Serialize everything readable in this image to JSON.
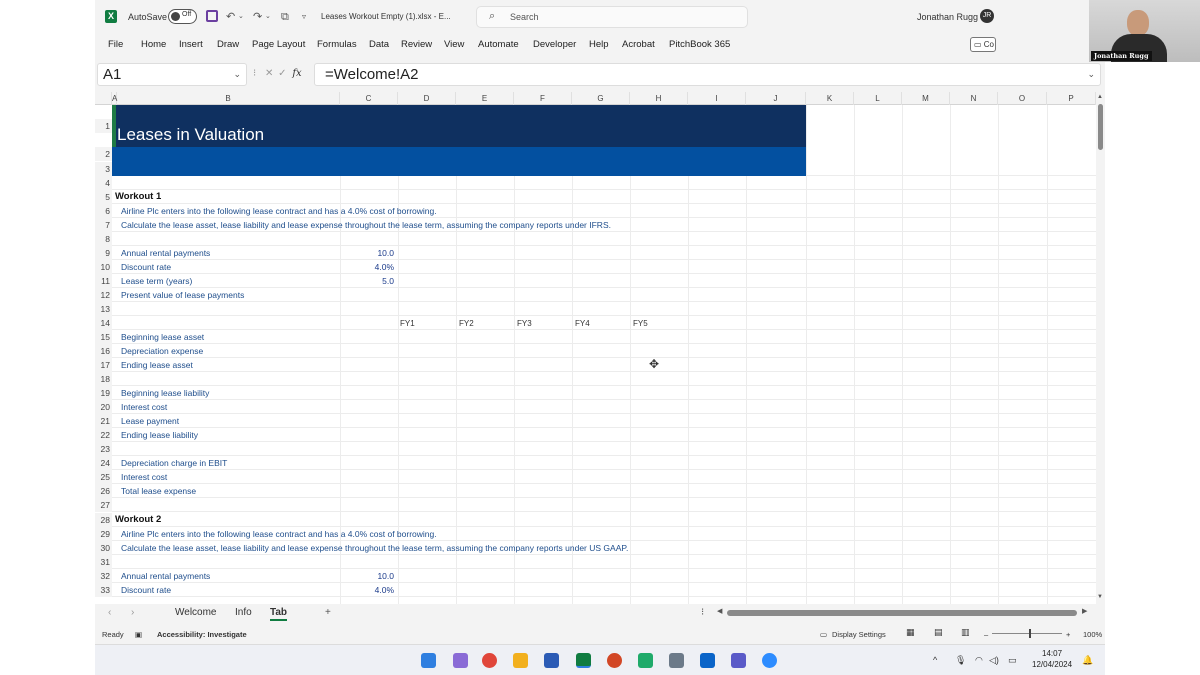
{
  "titlebar": {
    "app_icon": "X",
    "autosave_label": "AutoSave",
    "autosave_state": "Off",
    "filename": "Leases Workout Empty (1).xlsx  -  E...",
    "search_placeholder": "Search",
    "user_name": "Jonathan Rugg"
  },
  "menu": [
    "File",
    "Home",
    "Insert",
    "Draw",
    "Page Layout",
    "Formulas",
    "Data",
    "Review",
    "View",
    "Automate",
    "Developer",
    "Help",
    "Acrobat",
    "PitchBook 365"
  ],
  "comments_label": "Co",
  "formula_bar": {
    "name_box": "A1",
    "fx_label": "fx",
    "formula": "=Welcome!A2"
  },
  "columns": [
    "A",
    "B",
    "C",
    "D",
    "E",
    "F",
    "G",
    "H",
    "I",
    "J",
    "K",
    "L",
    "M",
    "N",
    "O",
    "P"
  ],
  "rows": [
    "1",
    "2",
    "3",
    "4",
    "5",
    "6",
    "7",
    "8",
    "9",
    "10",
    "11",
    "12",
    "13",
    "14",
    "15",
    "16",
    "17",
    "18",
    "19",
    "20",
    "21",
    "22",
    "23",
    "24",
    "25",
    "26",
    "27",
    "28",
    "29",
    "30",
    "31",
    "32",
    "33"
  ],
  "sheet": {
    "title": "Leases in Valuation",
    "workout1": {
      "heading": "Workout 1",
      "line1": "Airline Plc enters into the following lease contract and has a 4.0% cost of borrowing.",
      "line2": "Calculate the lease asset, lease liability and lease expense throughout the lease term, assuming the company reports under IFRS.",
      "inputs": [
        {
          "label": "Annual rental payments",
          "value": "10.0"
        },
        {
          "label": "Discount rate",
          "value": "4.0%"
        },
        {
          "label": "Lease term (years)",
          "value": "5.0"
        },
        {
          "label": "Present value of lease payments",
          "value": ""
        }
      ],
      "years": [
        "FY1",
        "FY2",
        "FY3",
        "FY4",
        "FY5"
      ],
      "asset_rows": [
        "Beginning lease asset",
        "Depreciation expense",
        "Ending lease asset"
      ],
      "liability_rows": [
        "Beginning lease liability",
        "Interest cost",
        "Lease payment",
        "Ending lease liability"
      ],
      "expense_rows": [
        "Depreciation charge in EBIT",
        "Interest cost",
        "Total lease expense"
      ]
    },
    "workout2": {
      "heading": "Workout 2",
      "line1": "Airline Plc enters into the following lease contract and has a 4.0% cost of borrowing.",
      "line2": "Calculate the lease asset, lease liability and lease expense throughout the lease term, assuming the company reports under US GAAP.",
      "inputs": [
        {
          "label": "Annual rental payments",
          "value": "10.0"
        },
        {
          "label": "Discount rate",
          "value": "4.0%"
        }
      ]
    }
  },
  "tabs": {
    "items": [
      "Welcome",
      "Info",
      "Tab"
    ],
    "active": "Tab",
    "add": "+"
  },
  "status": {
    "ready": "Ready",
    "accessibility": "Accessibility: Investigate",
    "display_settings": "Display Settings",
    "zoom": "100%"
  },
  "taskbar": {
    "time": "14:07",
    "date": "12/04/2024"
  },
  "webcam_label": "Jonathan Rugg",
  "colors": {
    "banner_dark": "#0f3060",
    "banner_blue": "#0350a0",
    "label_blue": "#1f4e8c",
    "excel_green": "#107c41"
  }
}
